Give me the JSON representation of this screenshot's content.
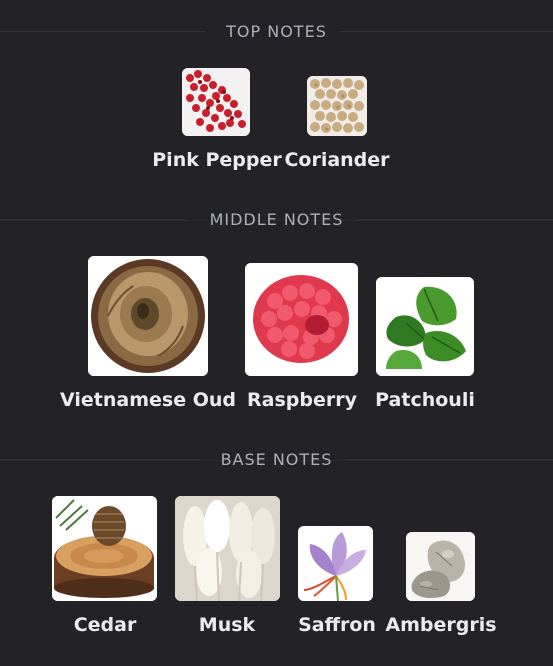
{
  "top_notes": {
    "title": "TOP NOTES",
    "items": [
      {
        "label": "Pink Pepper",
        "icon": "pink-pepper-image"
      },
      {
        "label": "Coriander",
        "icon": "coriander-image"
      }
    ]
  },
  "middle_notes": {
    "title": "MIDDLE NOTES",
    "items": [
      {
        "label": "Vietnamese Oud",
        "icon": "oud-wood-image"
      },
      {
        "label": "Raspberry",
        "icon": "raspberry-image"
      },
      {
        "label": "Patchouli",
        "icon": "patchouli-leaf-image"
      }
    ]
  },
  "base_notes": {
    "title": "BASE NOTES",
    "items": [
      {
        "label": "Cedar",
        "icon": "cedar-image"
      },
      {
        "label": "Musk",
        "icon": "musk-image"
      },
      {
        "label": "Saffron",
        "icon": "saffron-flower-image"
      },
      {
        "label": "Ambergris",
        "icon": "ambergris-stone-image"
      }
    ]
  },
  "colors": {
    "background": "#232226",
    "heading": "#aeb0b8",
    "label": "#ececef"
  }
}
